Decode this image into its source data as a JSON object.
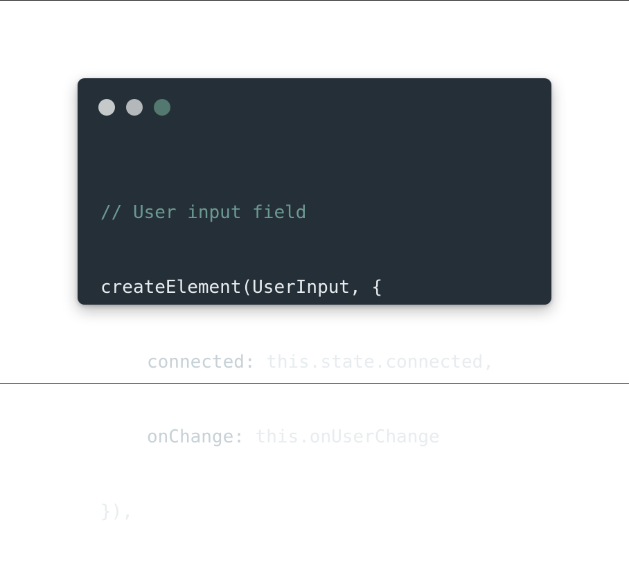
{
  "window": {
    "controls": [
      {
        "name": "close",
        "color": "#c6c9ca"
      },
      {
        "name": "minimize",
        "color": "#b4b8ba"
      },
      {
        "name": "maximize",
        "color": "#53786f"
      }
    ]
  },
  "code": {
    "comment": "// User input field",
    "call_open": "createElement(UserInput, {",
    "prop1_key": "connected:",
    "prop1_value": " this.state.connected,",
    "prop2_key": "onChange:",
    "prop2_value": " this.onUserChange",
    "call_close": "}),"
  },
  "colors": {
    "background": "#ffffff",
    "window_bg": "#252f37",
    "code_text": "#e7ecef",
    "comment_text": "#6c9a93"
  }
}
